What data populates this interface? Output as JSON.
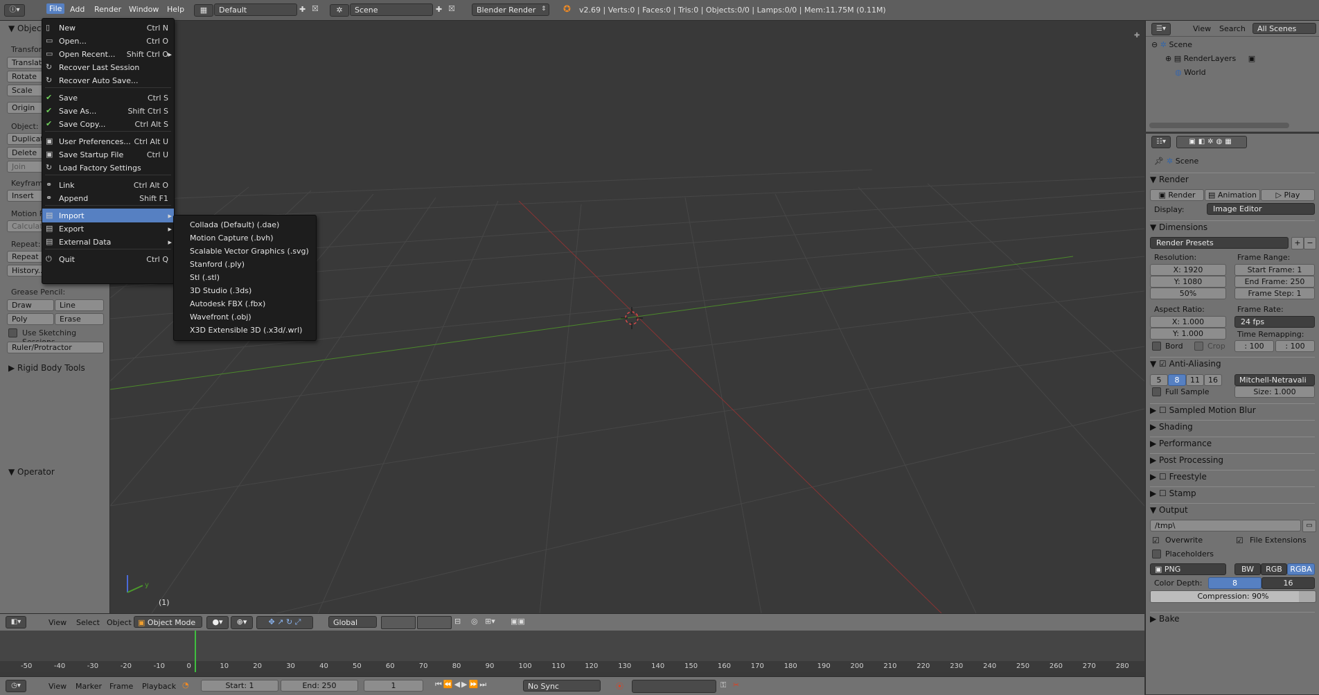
{
  "topbar": {
    "menus": [
      "File",
      "Add",
      "Render",
      "Window",
      "Help"
    ],
    "layout": "Default",
    "scene": "Scene",
    "engine": "Blender Render",
    "stats": "v2.69 | Verts:0 | Faces:0 | Tris:0 | Objects:0/0 | Lamps:0/0 | Mem:11.75M (0.11M)"
  },
  "file_menu": {
    "items": [
      {
        "label": "New",
        "shortcut": "Ctrl N"
      },
      {
        "label": "Open...",
        "shortcut": "Ctrl O"
      },
      {
        "label": "Open Recent...",
        "shortcut": "Shift Ctrl O"
      },
      {
        "label": "Recover Last Session",
        "shortcut": ""
      },
      {
        "label": "Recover Auto Save...",
        "shortcut": ""
      },
      {
        "label": "Save",
        "shortcut": "Ctrl S"
      },
      {
        "label": "Save As...",
        "shortcut": "Shift Ctrl S"
      },
      {
        "label": "Save Copy...",
        "shortcut": "Ctrl Alt S"
      },
      {
        "label": "User Preferences...",
        "shortcut": "Ctrl Alt U"
      },
      {
        "label": "Save Startup File",
        "shortcut": "Ctrl U"
      },
      {
        "label": "Load Factory Settings",
        "shortcut": ""
      },
      {
        "label": "Link",
        "shortcut": "Ctrl Alt O"
      },
      {
        "label": "Append",
        "shortcut": "Shift F1"
      },
      {
        "label": "Import",
        "shortcut": ""
      },
      {
        "label": "Export",
        "shortcut": ""
      },
      {
        "label": "External Data",
        "shortcut": ""
      },
      {
        "label": "Quit",
        "shortcut": "Ctrl Q"
      }
    ]
  },
  "import_submenu": [
    "Collada (Default) (.dae)",
    "Motion Capture (.bvh)",
    "Scalable Vector Graphics (.svg)",
    "Stanford (.ply)",
    "Stl (.stl)",
    "3D Studio (.3ds)",
    "Autodesk FBX (.fbx)",
    "Wavefront (.obj)",
    "X3D Extensible 3D (.x3d/.wrl)"
  ],
  "toolshelf": {
    "object_header": "Object",
    "transform": "Transform:",
    "translate": "Translate",
    "rotate": "Rotate",
    "scale": "Scale",
    "origin": "Origin",
    "object": "Object:",
    "duplicate": "Duplicate",
    "delete": "Delete",
    "join": "Join",
    "keyframes": "Keyframes:",
    "insert": "Insert",
    "motion_paths": "Motion Paths:",
    "calculate": "Calculate",
    "repeat": "Repeat:",
    "repeat_last": "Repeat Last",
    "history": "History...",
    "grease_pencil": "Grease Pencil:",
    "draw": "Draw",
    "line": "Line",
    "poly": "Poly",
    "erase": "Erase",
    "use_sketching": "Use Sketching Sessions",
    "ruler": "Ruler/Protractor",
    "rigid_body": "Rigid Body Tools",
    "operator": "Operator"
  },
  "viewport": {
    "frame_label": "(1)"
  },
  "view3d_header": {
    "view": "View",
    "select": "Select",
    "object": "Object",
    "mode": "Object Mode",
    "orientation": "Global"
  },
  "timeline": {
    "ticks": [
      "-50",
      "-40",
      "-30",
      "-20",
      "-10",
      "0",
      "10",
      "20",
      "30",
      "40",
      "50",
      "60",
      "70",
      "80",
      "90",
      "100",
      "110",
      "120",
      "130",
      "140",
      "150",
      "160",
      "170",
      "180",
      "190",
      "200",
      "210",
      "220",
      "230",
      "240",
      "250",
      "260",
      "270",
      "280"
    ],
    "current_frame": 1
  },
  "timeline_header": {
    "view": "View",
    "marker": "Marker",
    "frame": "Frame",
    "playback": "Playback",
    "start": "Start: 1",
    "end": "End: 250",
    "current": "1",
    "sync": "No Sync"
  },
  "outliner": {
    "view": "View",
    "search": "Search",
    "filter": "All Scenes",
    "items": [
      "Scene",
      "RenderLayers",
      "World"
    ]
  },
  "properties": {
    "context": "Scene",
    "render_header": "Render",
    "render_btn": "Render",
    "animation_btn": "Animation",
    "play_btn": "Play",
    "display_label": "Display:",
    "display_value": "Image Editor",
    "dimensions": "Dimensions",
    "presets": "Render Presets",
    "resolution": "Resolution:",
    "res_x": "X: 1920",
    "res_y": "Y: 1080",
    "res_pct": "50%",
    "frame_range": "Frame Range:",
    "start_frame": "Start Frame: 1",
    "end_frame": "End Frame: 250",
    "frame_step": "Frame Step: 1",
    "aspect": "Aspect Ratio:",
    "asp_x": "X: 1.000",
    "asp_y": "Y: 1.000",
    "frame_rate": "Frame Rate:",
    "fps": "24 fps",
    "time_remap": "Time Remapping:",
    "remap_old": ": 100",
    "remap_new": ": 100",
    "bord": "Bord",
    "crop": "Crop",
    "antialiasing": "Anti-Aliasing",
    "aa_samples": [
      "5",
      "8",
      "11",
      "16"
    ],
    "aa_filter": "Mitchell-Netravali",
    "full_sample": "Full Sample",
    "size": "Size: 1.000",
    "sampled_motion_blur": "Sampled Motion Blur",
    "shading": "Shading",
    "performance": "Performance",
    "post_processing": "Post Processing",
    "freestyle": "Freestyle",
    "stamp": "Stamp",
    "output": "Output",
    "output_path": "/tmp\\",
    "overwrite": "Overwrite",
    "file_extensions": "File Extensions",
    "placeholders": "Placeholders",
    "format": "PNG",
    "bw": "BW",
    "rgb": "RGB",
    "rgba": "RGBA",
    "color_depth": "Color Depth:",
    "depth_8": "8",
    "depth_16": "16",
    "compression": "Compression: 90%",
    "bake": "Bake"
  }
}
